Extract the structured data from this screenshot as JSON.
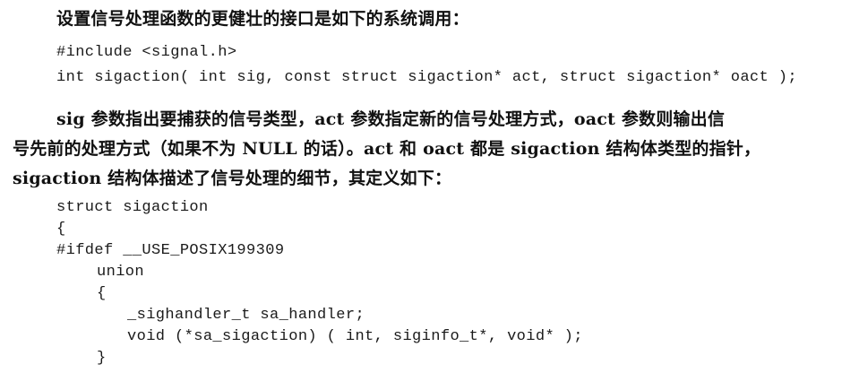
{
  "paragraphs": {
    "intro": "设置信号处理函数的更健壮的接口是如下的系统调用：",
    "desc_line1": "sig 参数指出要捕获的信号类型，act 参数指定新的信号处理方式，oact 参数则输出信",
    "desc_line2": "号先前的处理方式（如果不为 NULL 的话）。act 和 oact 都是 sigaction 结构体类型的指针，",
    "desc_line3": "sigaction 结构体描述了信号处理的细节，其定义如下："
  },
  "code_block_1": {
    "line1": "#include <signal.h>",
    "line2": "int sigaction( int sig, const struct sigaction* act, struct sigaction* oact );"
  },
  "code_block_2": {
    "line1": "struct sigaction",
    "line2": "{",
    "line3": "#ifdef __USE_POSIX199309",
    "line4": "union",
    "line5": "{",
    "line6": "_sighandler_t sa_handler;",
    "line7": "void (*sa_sigaction) ( int, siginfo_t*, void* );",
    "line8": "}"
  }
}
